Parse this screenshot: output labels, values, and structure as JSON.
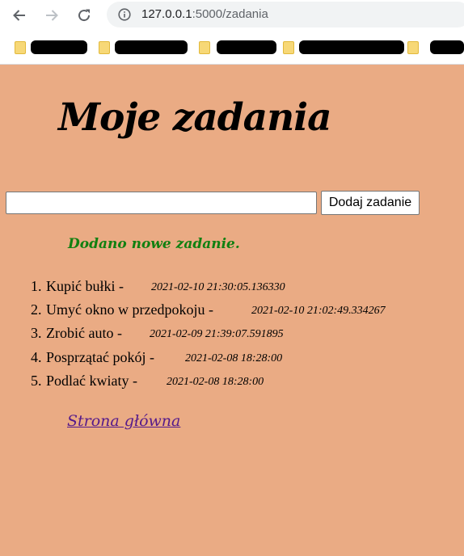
{
  "browser": {
    "url_host": "127.0.0.1",
    "url_rest": ":5000/zadania",
    "bookmarks_count_note": ""
  },
  "page": {
    "title": "Moje zadania",
    "input_value": "",
    "add_button_label": "Dodaj zadanie",
    "flash_message": "Dodano nowe zadanie.",
    "home_link": "Strona główna",
    "background_color": "#eaab84",
    "flash_color": "#118011",
    "link_color": "#551a8b"
  },
  "tasks": [
    {
      "num": "1.",
      "name": "Kupić bułki -",
      "date": "2021-02-10 21:30:05.136330"
    },
    {
      "num": "2.",
      "name": "Umyć okno w przedpokoju -",
      "date": "2021-02-10 21:02:49.334267"
    },
    {
      "num": "3.",
      "name": "Zrobić auto -",
      "date": "2021-02-09 21:39:07.591895"
    },
    {
      "num": "4.",
      "name": "Posprzątać pokój -",
      "date": "2021-02-08 18:28:00"
    },
    {
      "num": "5.",
      "name": "Podlać kwiaty -",
      "date": "2021-02-08 18:28:00"
    }
  ],
  "icons": {
    "back": "arrow-left-icon",
    "forward": "arrow-right-icon",
    "reload": "reload-icon",
    "info": "info-icon",
    "bookmark": "folder-icon"
  }
}
